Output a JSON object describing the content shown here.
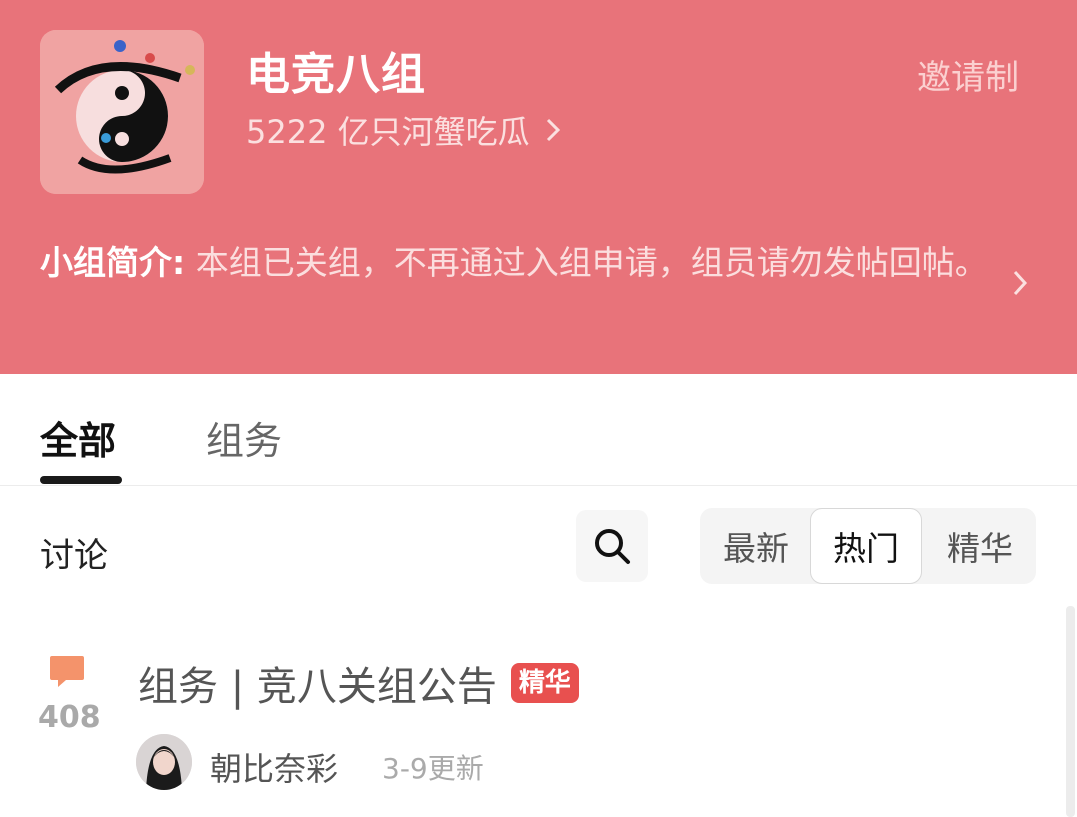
{
  "group": {
    "name": "电竞八组",
    "members_line": "5222 亿只河蟹吃瓜",
    "invite_label": "邀请制",
    "intro_label": "小组简介:",
    "intro_text": " 本组已关组，不再通过入组申请，组员请勿发帖回帖。"
  },
  "tabs": [
    {
      "label": "全部",
      "active": true
    },
    {
      "label": "组务",
      "active": false
    }
  ],
  "discussion": {
    "label": "讨论",
    "sort_options": [
      "最新",
      "热门",
      "精华"
    ],
    "selected_sort": "热门"
  },
  "posts": [
    {
      "title": "组务 | 竞八关组公告",
      "badge": "精华",
      "comment_count": "408",
      "author": "朝比奈彩",
      "updated": "3-9更新"
    }
  ],
  "colors": {
    "header_bg": "#e8737a",
    "badge_bg": "#e8504f",
    "comment_icon": "#f4936b"
  }
}
